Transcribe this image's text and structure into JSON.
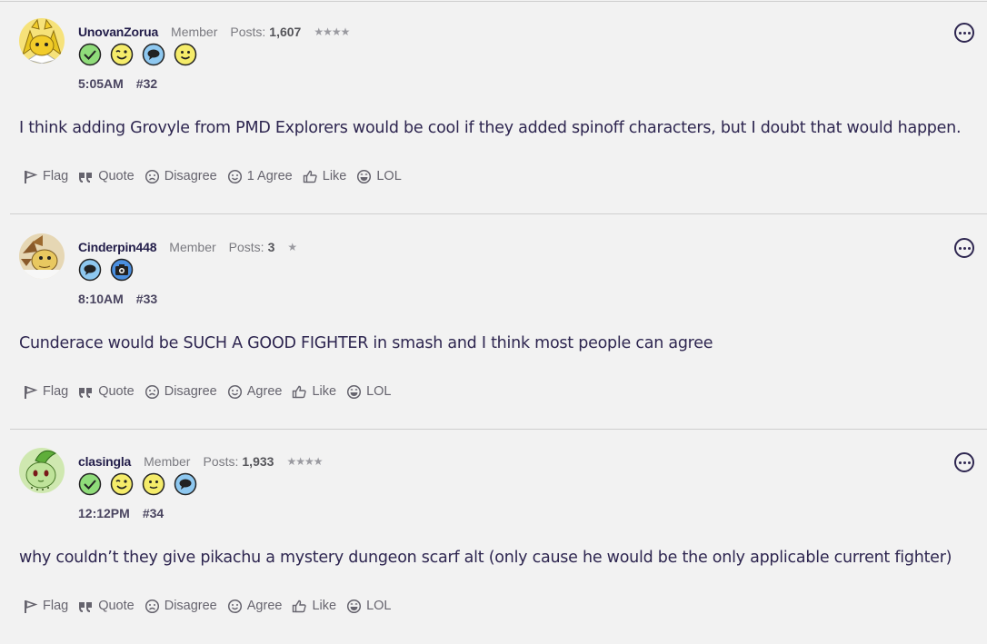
{
  "posts": [
    {
      "username": "UnovanZorua",
      "role": "Member",
      "posts_label": "Posts:",
      "posts_count": "1,607",
      "stars": "★★★★",
      "badges": [
        "check-badge-icon",
        "wink-badge-icon",
        "speech-bubble-badge-icon",
        "smile-badge-icon"
      ],
      "time": "5:05AM",
      "post_number": "#32",
      "body": "I think adding Grovyle from PMD Explorers would be cool if they added spinoff characters, but I doubt that would happen.",
      "actions": {
        "flag": "Flag",
        "quote": "Quote",
        "disagree": "Disagree",
        "agree": "1 Agree",
        "like": "Like",
        "lol": "LOL"
      }
    },
    {
      "username": "Cinderpin448",
      "role": "Member",
      "posts_label": "Posts:",
      "posts_count": "3",
      "stars": "★",
      "badges": [
        "speech-bubble-badge-icon",
        "camera-badge-icon"
      ],
      "time": "8:10AM",
      "post_number": "#33",
      "body": "Cunderace would be SUCH A GOOD FIGHTER in smash and I think most people can agree",
      "actions": {
        "flag": "Flag",
        "quote": "Quote",
        "disagree": "Disagree",
        "agree": "Agree",
        "like": "Like",
        "lol": "LOL"
      }
    },
    {
      "username": "clasingla",
      "role": "Member",
      "posts_label": "Posts:",
      "posts_count": "1,933",
      "stars": "★★★★",
      "badges": [
        "check-badge-icon",
        "wink-badge-icon",
        "smile-badge-icon",
        "speech-bubble-badge-icon"
      ],
      "time": "12:12PM",
      "post_number": "#34",
      "body": "why couldn’t they give pikachu a mystery dungeon scarf alt (only cause he would be the only applicable current fighter)",
      "actions": {
        "flag": "Flag",
        "quote": "Quote",
        "disagree": "Disagree",
        "agree": "Agree",
        "like": "Like",
        "lol": "LOL"
      }
    }
  ],
  "colors": {
    "background": "#f2f2f2",
    "text": "#2e2650",
    "muted": "#66646e",
    "divider": "#cfcfcf"
  }
}
